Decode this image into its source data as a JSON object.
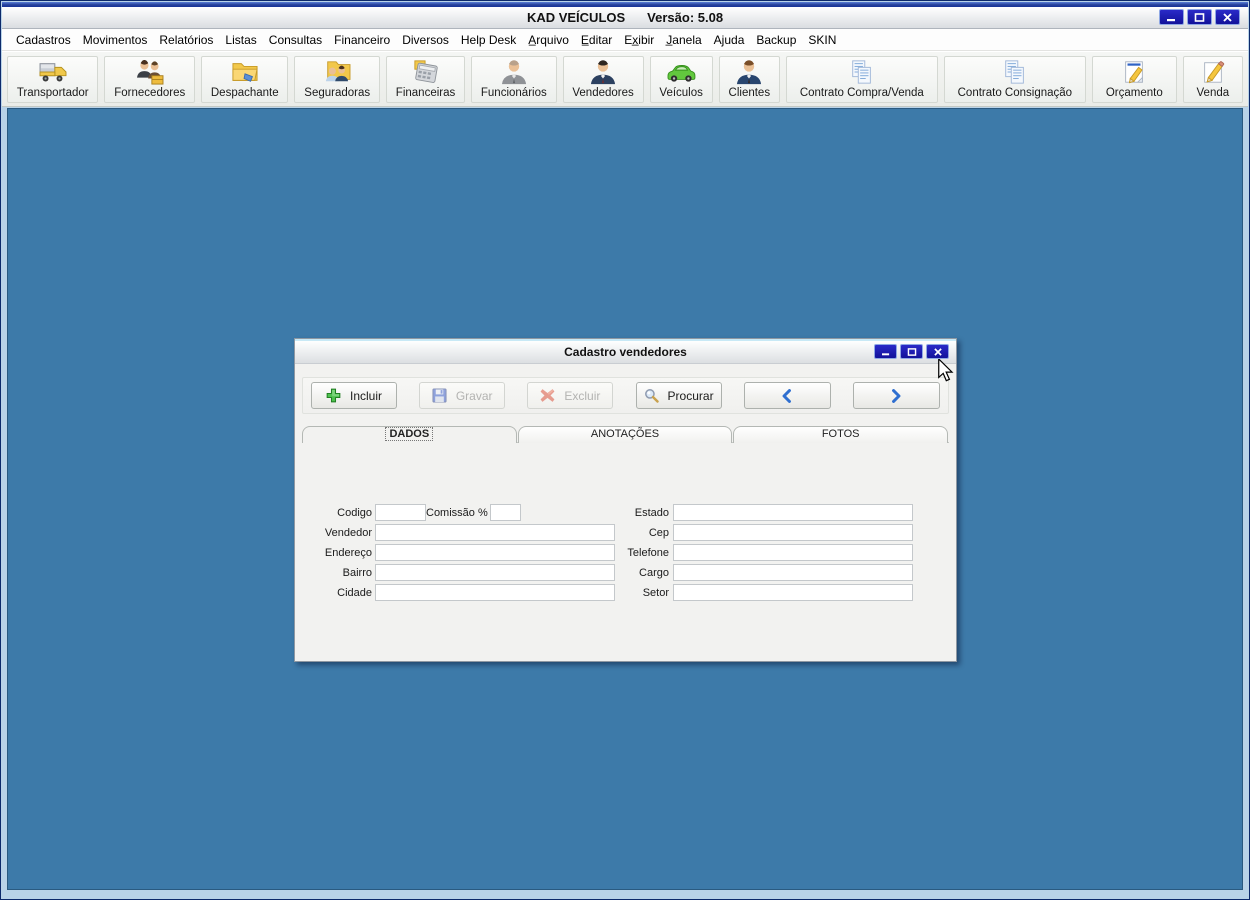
{
  "titlebar": {
    "title": "KAD VEÍCULOS",
    "version": "Versão: 5.08",
    "window_icons": [
      "minimize-icon",
      "maximize-icon",
      "close-icon"
    ]
  },
  "menu": {
    "items": [
      "Cadastros",
      "Movimentos",
      "Relatórios",
      "Listas",
      "Consultas",
      "Financeiro",
      "Diversos",
      "Help Desk",
      "A̲rquivo",
      "E̲ditar",
      "Ex̲ibir",
      "J̲anela",
      "Ajuda",
      "Backup",
      "SKIN"
    ]
  },
  "toolbar": {
    "buttons": [
      {
        "label": "Transportador",
        "icon": "truck-icon"
      },
      {
        "label": "Fornecedores",
        "icon": "suppliers-people-icon"
      },
      {
        "label": "Despachante",
        "icon": "folder-hand-icon"
      },
      {
        "label": "Seguradoras",
        "icon": "folder-people-icon"
      },
      {
        "label": "Financeiras",
        "icon": "calculator-icon"
      },
      {
        "label": "Funcionários",
        "icon": "employee-person-icon"
      },
      {
        "label": "Vendedores",
        "icon": "salesman-person-icon"
      },
      {
        "label": "Veículos",
        "icon": "car-icon"
      },
      {
        "label": "Clientes",
        "icon": "client-person-icon"
      },
      {
        "label": "Contrato Compra/Venda",
        "icon": "contract-documents-icon"
      },
      {
        "label": "Contrato Consignação",
        "icon": "contract-documents-icon"
      },
      {
        "label": "Orçamento",
        "icon": "note-pencil-icon"
      },
      {
        "label": "Venda",
        "icon": "page-pencil-icon"
      }
    ]
  },
  "child_window": {
    "title": "Cadastro vendedores",
    "window_icons": [
      "minimize-icon",
      "maximize-icon",
      "close-icon"
    ],
    "actions": [
      {
        "label": "Incluir",
        "icon": "add-plus-icon",
        "enabled": true
      },
      {
        "label": "Gravar",
        "icon": "save-floppy-icon",
        "enabled": false
      },
      {
        "label": "Excluir",
        "icon": "delete-x-icon",
        "enabled": false
      },
      {
        "label": "Procurar",
        "icon": "search-icon",
        "enabled": true
      },
      {
        "label": "",
        "icon": "previous-arrow-icon",
        "enabled": true
      },
      {
        "label": "",
        "icon": "next-arrow-icon",
        "enabled": true
      }
    ],
    "tabs": [
      {
        "label": "DADOS",
        "active": true
      },
      {
        "label": "ANOTAÇÕES",
        "active": false
      },
      {
        "label": "FOTOS",
        "active": false
      }
    ],
    "form": {
      "labels": {
        "codigo": "Codigo",
        "comissao": "Comissão %",
        "vendedor": "Vendedor",
        "endereco": "Endereço",
        "bairro": "Bairro",
        "cidade": "Cidade",
        "estado": "Estado",
        "cep": "Cep",
        "telefone": "Telefone",
        "cargo": "Cargo",
        "setor": "Setor"
      },
      "values": {
        "codigo": "",
        "comissao": "",
        "vendedor": "",
        "endereco": "",
        "bairro": "",
        "cidade": "",
        "estado": "",
        "cep": "",
        "telefone": "",
        "cargo": "",
        "setor": ""
      }
    }
  },
  "colors": {
    "mdi_background": "#3d7aa9",
    "window_control_button": "#1616a8",
    "titlebar_gradient_top": "#ffffff",
    "accent_arrow_blue": "#2f6fd0",
    "disabled_text": "#b3b3b1",
    "add_green": "#3cb53c",
    "delete_red": "#d23b2a",
    "save_blue": "#2b51c7"
  }
}
